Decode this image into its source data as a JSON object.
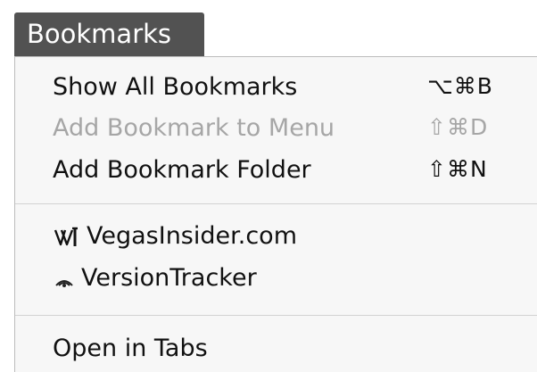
{
  "menubar": {
    "title": "Bookmarks"
  },
  "menu": {
    "items": [
      {
        "label": "Show All Bookmarks",
        "shortcut": "⌥⌘B",
        "enabled": true
      },
      {
        "label": "Add Bookmark to Menu",
        "shortcut": "⇧⌘D",
        "enabled": false
      },
      {
        "label": "Add Bookmark Folder",
        "shortcut": "⇧⌘N",
        "enabled": true
      }
    ],
    "bookmarks": [
      {
        "label": "VegasInsider.com",
        "icon": "vegasinsider-favicon-icon"
      },
      {
        "label": "VersionTracker",
        "icon": "versiontracker-favicon-icon"
      }
    ],
    "open_in_tabs": "Open in Tabs"
  },
  "colors": {
    "title_bar_bg": "#525252",
    "menu_bg": "#f7f7f7",
    "disabled_text": "#a6a6a6"
  }
}
